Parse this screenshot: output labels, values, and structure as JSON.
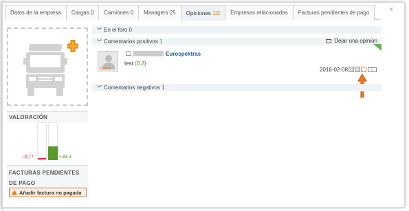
{
  "tabs": [
    {
      "label": "Datos de la empresa"
    },
    {
      "label": "Cargas 0"
    },
    {
      "label": "Camiones 0"
    },
    {
      "label": "Managers 25"
    },
    {
      "label_prefix": "Opiniones ",
      "label_count": "1",
      "label_sep": "/",
      "label_total": "2"
    },
    {
      "label": "Empresas relacionadas"
    },
    {
      "label": "Facturas pendientes de pago"
    }
  ],
  "close_glyph": "×",
  "left": {
    "valoracion_title": "VALORACIÓN",
    "neg_value": "-0,77",
    "pos_value": "+38,3",
    "facturas_title": "FACTURAS PENDIENTES DE PAGO",
    "add_invoice_button": "Añadir factura no pagada"
  },
  "forum": {
    "label": "En el foro 0"
  },
  "positive": {
    "label_prefix": "Comentarios positivos",
    "count": "1",
    "leave_opinion": "Dejar una opinión"
  },
  "comment": {
    "company": "Eurospektras",
    "text": "test",
    "score": "(0.2)",
    "date": "2016-02-08",
    "avatar_tag": "CARGO"
  },
  "negative": {
    "label_prefix": "Comentarios negativos",
    "count": "1"
  },
  "colors": {
    "accent": "#f07a1a",
    "positive": "#5a9a2a",
    "negative": "#d0202a",
    "link": "#1a5aa0"
  },
  "icons": [
    "chevron-down-icon",
    "speech-bubble-icon",
    "truck-icon",
    "plus-icon",
    "warning-icon",
    "message-icon",
    "arrow-up-icon"
  ]
}
